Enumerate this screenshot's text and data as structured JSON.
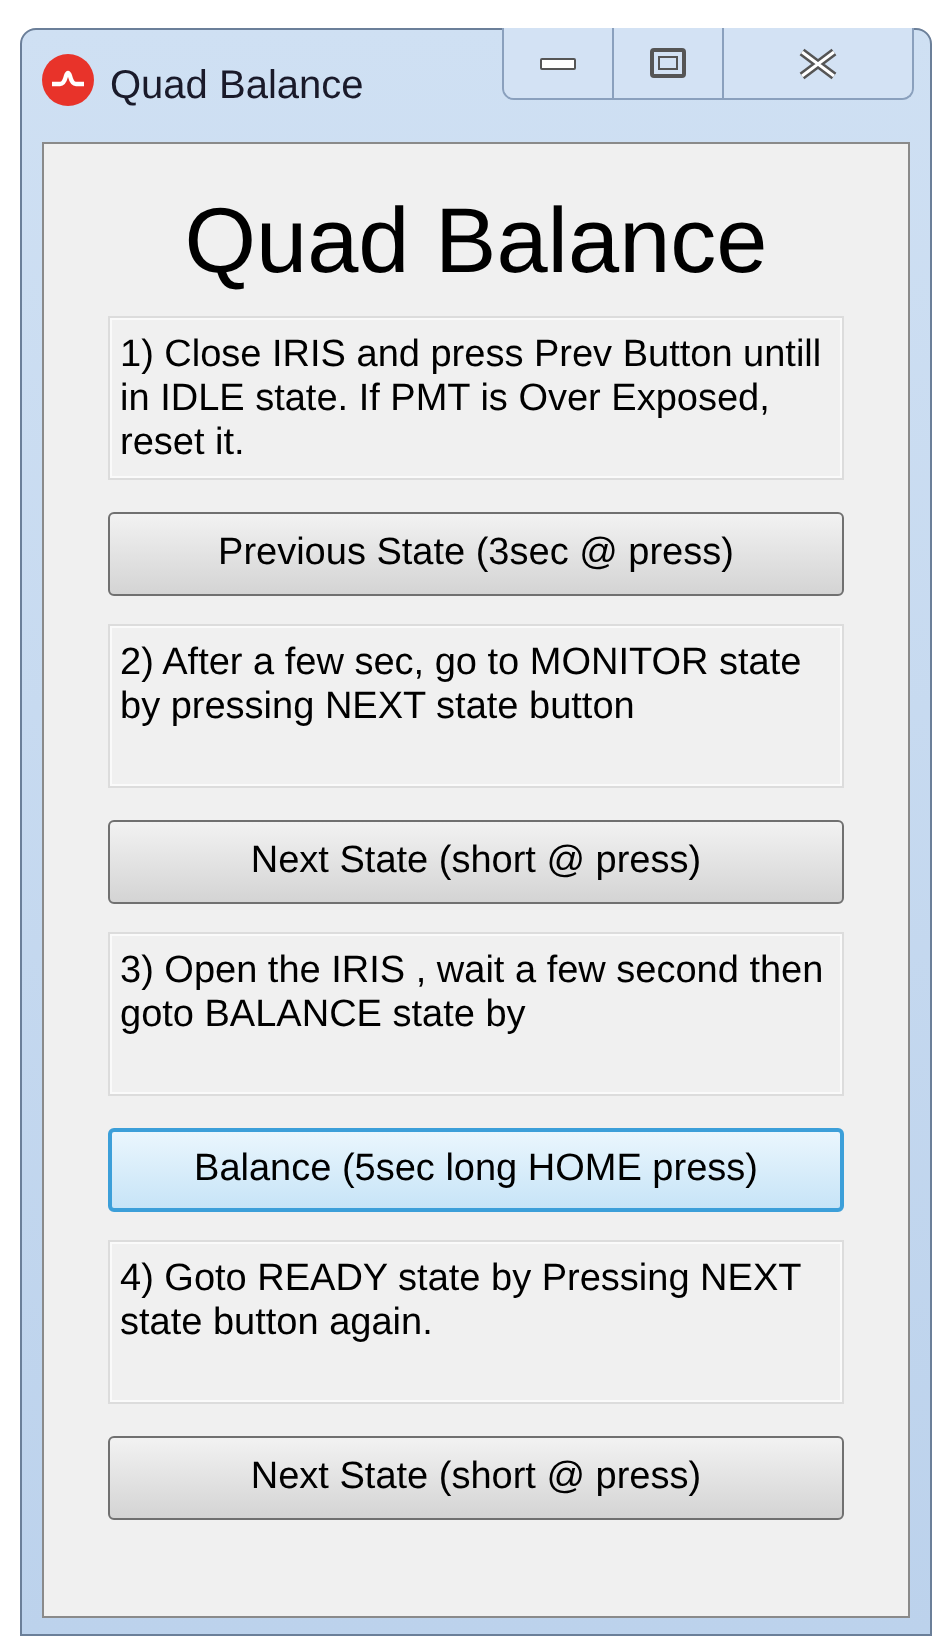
{
  "window": {
    "title": "Quad Balance"
  },
  "heading": "Quad Balance",
  "steps": [
    {
      "kind": "instruction",
      "text": "1) Close IRIS and press Prev Button untill in IDLE state. If PMT is Over Exposed, reset it."
    },
    {
      "kind": "button",
      "label": "Previous State (3sec @ press)",
      "focused": false
    },
    {
      "kind": "instruction",
      "text": "2) After a few sec, go to MONITOR state by pressing NEXT state button"
    },
    {
      "kind": "button",
      "label": "Next State (short @ press)",
      "focused": false
    },
    {
      "kind": "instruction",
      "text": "3) Open the IRIS , wait a few second then goto BALANCE state by"
    },
    {
      "kind": "button",
      "label": "Balance (5sec long HOME press)",
      "focused": true
    },
    {
      "kind": "instruction",
      "text": "4) Goto READY state by Pressing NEXT state button again."
    },
    {
      "kind": "button",
      "label": "Next State (short @ press)",
      "focused": false
    }
  ]
}
